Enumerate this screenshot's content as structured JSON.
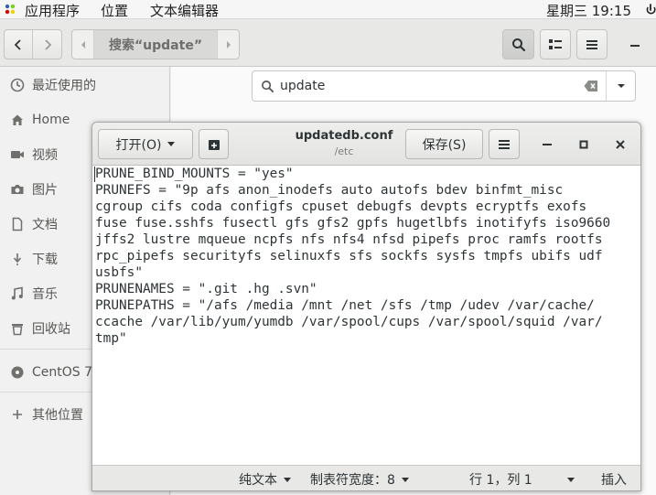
{
  "topbar": {
    "menus": [
      "应用程序",
      "位置",
      "文本编辑器"
    ],
    "clock": "星期三 19:15"
  },
  "files": {
    "search_crumb": "搜索“update”",
    "search_value": "update",
    "sidebar": [
      {
        "label": "最近使用的",
        "icon": "clock-icon"
      },
      {
        "label": "Home",
        "icon": "home-icon"
      },
      {
        "label": "视频",
        "icon": "video-icon"
      },
      {
        "label": "图片",
        "icon": "camera-icon"
      },
      {
        "label": "文档",
        "icon": "document-icon"
      },
      {
        "label": "下载",
        "icon": "download-icon"
      },
      {
        "label": "音乐",
        "icon": "music-icon"
      },
      {
        "label": "回收站",
        "icon": "trash-icon"
      },
      {
        "label": "CentOS 7",
        "icon": "disc-icon"
      },
      {
        "label": "其他位置",
        "icon": "plus-icon"
      }
    ]
  },
  "gedit": {
    "open_label": "打开(O)",
    "save_label": "保存(S)",
    "filename": "updatedb.conf",
    "path": "/etc",
    "lines": [
      "PRUNE_BIND_MOUNTS = \"yes\"",
      "PRUNEFS = \"9p afs anon_inodefs auto autofs bdev binfmt_misc",
      "cgroup cifs coda configfs cpuset debugfs devpts ecryptfs exofs",
      "fuse fuse.sshfs fusectl gfs gfs2 gpfs hugetlbfs inotifyfs iso9660",
      "jffs2 lustre mqueue ncpfs nfs nfs4 nfsd pipefs proc ramfs rootfs",
      "rpc_pipefs securityfs selinuxfs sfs sockfs sysfs tmpfs ubifs udf",
      "usbfs\"",
      "PRUNENAMES = \".git .hg .svn\"",
      "PRUNEPATHS = \"/afs /media /mnt /net /sfs /tmp /udev /var/cache/",
      "ccache /var/lib/yum/yumdb /var/spool/cups /var/spool/squid /var/",
      "tmp\""
    ],
    "status": {
      "syntax": "纯文本",
      "tab_width": "制表符宽度：8",
      "position": "行 1，列 1",
      "mode": "插入"
    }
  },
  "colors": {
    "panel_bg": "#f6f6f6",
    "sidebar_bg": "#f1f1f1",
    "header_bg": "#e8e8e7",
    "text": "#2e3436"
  }
}
